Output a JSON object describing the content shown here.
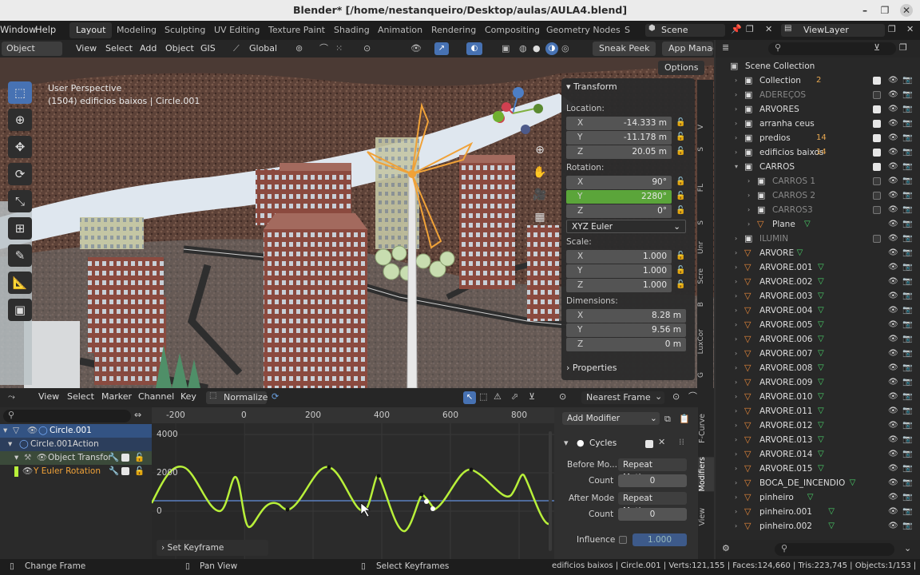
{
  "window": {
    "title": "Blender* [/home/nestanqueiro/Desktop/aulas/AULA4.blend]"
  },
  "menubar": {
    "items": [
      "Window",
      "Help"
    ],
    "workspaces": [
      "Layout",
      "Modeling",
      "Sculpting",
      "UV Editing",
      "Texture Paint",
      "Shading",
      "Animation",
      "Rendering",
      "Compositing",
      "Geometry Nodes",
      "S"
    ],
    "active_workspace": "Layout",
    "scene": "Scene",
    "view_layer": "ViewLayer"
  },
  "viewport_header": {
    "mode": "Object Mode",
    "menus": [
      "View",
      "Select",
      "Add",
      "Object",
      "GIS"
    ],
    "orientation": "Global",
    "sneak_peek": "Sneak Peek",
    "app_manager": "App Manag",
    "options": "Options"
  },
  "viewport": {
    "perspective": "User Perspective",
    "info": "(1504) edificios baixos | Circle.001"
  },
  "npanel": {
    "header": "Transform",
    "location_label": "Location:",
    "location": [
      {
        "axis": "X",
        "value": "-14.333 m"
      },
      {
        "axis": "Y",
        "value": "-11.178 m"
      },
      {
        "axis": "Z",
        "value": "20.05 m"
      }
    ],
    "rotation_label": "Rotation:",
    "rotation": [
      {
        "axis": "X",
        "value": "90°"
      },
      {
        "axis": "Y",
        "value": "2280°"
      },
      {
        "axis": "Z",
        "value": "0°"
      }
    ],
    "rotation_mode": "XYZ Euler",
    "scale_label": "Scale:",
    "scale": [
      {
        "axis": "X",
        "value": "1.000"
      },
      {
        "axis": "Y",
        "value": "1.000"
      },
      {
        "axis": "Z",
        "value": "1.000"
      }
    ],
    "dimensions_label": "Dimensions:",
    "dimensions": [
      {
        "axis": "X",
        "value": "8.28 m"
      },
      {
        "axis": "Y",
        "value": "9.56 m"
      },
      {
        "axis": "Z",
        "value": "0 m"
      }
    ],
    "properties": "Properties",
    "tabs": [
      "V",
      "S",
      "FL",
      "S",
      "Unr",
      "Scre",
      "B",
      "LuxCor",
      "G"
    ]
  },
  "outliner": {
    "root": "Scene Collection",
    "rows": [
      {
        "label": "Collection",
        "icon": "collection",
        "badge": "2",
        "dim": false,
        "on": true
      },
      {
        "label": "ADEREÇOS",
        "icon": "collection",
        "dim": true,
        "on": false
      },
      {
        "label": "ARVORES",
        "icon": "collection",
        "dim": false,
        "on": true
      },
      {
        "label": "arranha ceus",
        "icon": "collection",
        "dim": false,
        "on": true
      },
      {
        "label": "predios",
        "icon": "collection",
        "badge": "14",
        "dim": false,
        "on": true
      },
      {
        "label": "edificios baixos",
        "icon": "collection",
        "badge": "14",
        "dim": false,
        "on": true
      },
      {
        "label": "CARROS",
        "icon": "collection",
        "dim": false,
        "on": true
      },
      {
        "label": "CARROS 1",
        "icon": "collection",
        "dim": true,
        "on": false
      },
      {
        "label": "CARROS 2",
        "icon": "collection",
        "dim": true,
        "on": false
      },
      {
        "label": "CARROS3",
        "icon": "collection",
        "dim": true,
        "on": false
      },
      {
        "label": "Plane",
        "icon": "mesh",
        "dim": false,
        "on": true
      },
      {
        "label": "ILUMIN",
        "icon": "collection",
        "dim": true,
        "on": false
      },
      {
        "label": "ARVORE",
        "icon": "mesh",
        "dim": false,
        "on": true
      },
      {
        "label": "ARVORE.001",
        "icon": "mesh",
        "dim": false,
        "on": true
      },
      {
        "label": "ARVORE.002",
        "icon": "mesh",
        "dim": false,
        "on": true
      },
      {
        "label": "ARVORE.003",
        "icon": "mesh",
        "dim": false,
        "on": true
      },
      {
        "label": "ARVORE.004",
        "icon": "mesh",
        "dim": false,
        "on": true
      },
      {
        "label": "ARVORE.005",
        "icon": "mesh",
        "dim": false,
        "on": true
      },
      {
        "label": "ARVORE.006",
        "icon": "mesh",
        "dim": false,
        "on": true
      },
      {
        "label": "ARVORE.007",
        "icon": "mesh",
        "dim": false,
        "on": true
      },
      {
        "label": "ARVORE.008",
        "icon": "mesh",
        "dim": false,
        "on": true
      },
      {
        "label": "ARVORE.009",
        "icon": "mesh",
        "dim": false,
        "on": true
      },
      {
        "label": "ARVORE.010",
        "icon": "mesh",
        "dim": false,
        "on": true
      },
      {
        "label": "ARVORE.011",
        "icon": "mesh",
        "dim": false,
        "on": true
      },
      {
        "label": "ARVORE.012",
        "icon": "mesh",
        "dim": false,
        "on": true
      },
      {
        "label": "ARVORE.013",
        "icon": "mesh",
        "dim": false,
        "on": true
      },
      {
        "label": "ARVORE.014",
        "icon": "mesh",
        "dim": false,
        "on": true
      },
      {
        "label": "ARVORE.015",
        "icon": "mesh",
        "dim": false,
        "on": true
      },
      {
        "label": "BOCA_DE_INCENDIO",
        "icon": "mesh",
        "dim": false,
        "on": true
      },
      {
        "label": "pinheiro",
        "icon": "mesh",
        "dim": false,
        "on": true
      },
      {
        "label": "pinheiro.001",
        "icon": "mesh",
        "dim": false,
        "on": true
      },
      {
        "label": "pinheiro.002",
        "icon": "mesh",
        "dim": false,
        "on": true
      }
    ]
  },
  "graph_header": {
    "menus": [
      "View",
      "Select",
      "Marker",
      "Channel",
      "Key"
    ],
    "normalize": "Normalize",
    "interpolation": "Nearest Frame"
  },
  "graph": {
    "frame_ticks": [
      "-200",
      "0",
      "200",
      "400",
      "600",
      "800"
    ],
    "value_ticks": [
      "4000",
      "2000",
      "0"
    ],
    "channels": [
      {
        "label": "Circle.001"
      },
      {
        "label": "Circle.001Action"
      },
      {
        "label": "Object Transfor"
      },
      {
        "label": "Y Euler Rotation"
      }
    ],
    "hud": "Set Keyframe Extrapolati"
  },
  "modifier_panel": {
    "add_modifier": "Add Modifier",
    "name": "Cycles",
    "before_mode_label": "Before Mo...",
    "before_mode": "Repeat Motion",
    "count_label": "Count",
    "before_count": "0",
    "after_mode_label": "After Mode",
    "after_mode": "Repeat Motion",
    "after_count": "0",
    "influence_label": "Influence",
    "influence": "1.000",
    "tabs": [
      "F-Curve",
      "Modifiers",
      "View"
    ]
  },
  "statusbar": {
    "left": "Change Frame",
    "middle": "Pan View",
    "right": "Select Keyframes",
    "stats": "edificios baixos | Circle.001 | Verts:121,155 | Faces:124,660 | Tris:223,745 | Objects:1/153 |"
  },
  "colors": {
    "accent": "#4772b3",
    "green_field": "#5ba53a",
    "curve": "#b8f03a",
    "collection_icon": "#e0e0e0",
    "mesh_icon": "#e8883a",
    "modifier_icon": "#4ad36a"
  }
}
